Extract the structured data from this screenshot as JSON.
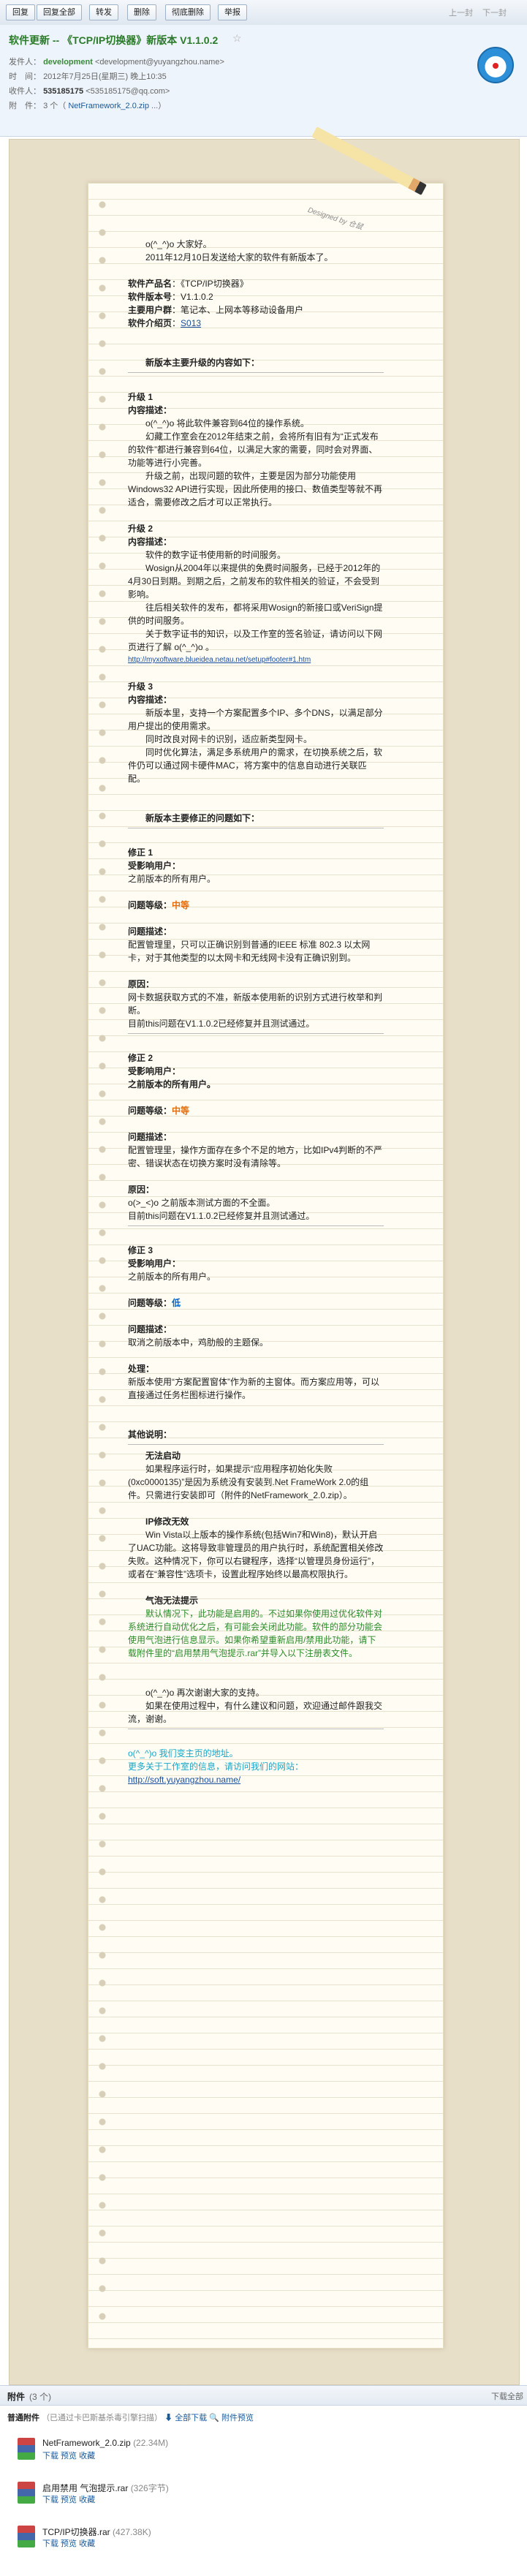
{
  "toolbar": {
    "buttons": [
      "回复",
      "回复全部",
      "转发",
      "删除",
      "彻底删除",
      "举报"
    ],
    "prev": "上一封",
    "next": "下一封"
  },
  "header": {
    "subject": "软件更新 -- 《TCP/IP切换器》新版本 V1.1.0.2",
    "star": "☆",
    "sender_label": "发件人：",
    "sender_name": "development",
    "sender_email": "<development@yuyangzhou.name>",
    "time_label": "时　间：",
    "time_value": "2012年7月25日(星期三) 晚上10:35",
    "to_label": "收件人：",
    "to_name": "535185175",
    "to_email": "<535185175@qq.com>",
    "attach_label": "附　件：",
    "attach_value": "3 个（",
    "attach_link": "NetFramework_2.0.zip",
    "attach_more": "...）"
  },
  "designed": "Designed by 仓鼠",
  "body": {
    "greet1": "o(^_^)o 大家好。",
    "greet2": "2011年12月10日发送给大家的软件有新版本了。",
    "p_name_label": "软件产品名",
    "p_name_value": "：《TCP/IP切换器》",
    "p_ver_label": "软件版本号",
    "p_ver_value": "：V1.1.0.2",
    "p_user_label": "主要用户群",
    "p_user_value": "：笔记本、上网本等移动设备用户",
    "p_intro_label": "软件介绍页",
    "p_intro_value": "S013",
    "upgrade_title": "新版本主要升级的内容如下：",
    "u1_title": "升级 1",
    "u1_desc": "内容描述：",
    "u1_p1": "o(^_^)o 将此软件兼容到64位的操作系统。",
    "u1_p2": "幻藏工作室会在2012年结束之前，会将所有旧有为“正式发布的软件”都进行兼容到64位，以满足大家的需要，同时会对界面、功能等进行小完善。",
    "u1_p3": "升级之前，出现问题的软件，主要是因为部分功能使用Windows32 API进行实现，因此所使用的接口、数值类型等就不再适合，需要修改之后才可以正常执行。",
    "u2_title": "升级 2",
    "u2_desc": "内容描述：",
    "u2_p1": "软件的数字证书使用新的时间服务。",
    "u2_p2": "Wosign从2004年以来提供的免费时间服务，已经于2012年的4月30日到期。到期之后，之前发布的软件相关的验证，不会受到影响。",
    "u2_p3": "往后相关软件的发布，都将采用Wosign的新接口或VeriSign提供的时间服务。",
    "u2_p4": "关于数字证书的知识，以及工作室的签名验证，请访问以下网页进行了解 o(^_^)o 。",
    "u2_link": "http://myxoftware.blueidea.netau.net/setup#footer#1.htm",
    "u3_title": "升级 3",
    "u3_desc": "内容描述：",
    "u3_p1": "新版本里，支持一个方案配置多个IP、多个DNS，以满足部分用户提出的使用需求。",
    "u3_p2": "同时改良对网卡的识别，适应新类型网卡。",
    "u3_p3": "同时优化算法，满足多系统用户的需求，在切换系统之后，软件仍可以通过网卡硬件MAC，将方案中的信息自动进行关联匹配。",
    "fix_title": "新版本主要修正的问题如下：",
    "f1_title": "修正 1",
    "f1_users_label": "受影响用户：",
    "f1_users": "之前版本的所有用户。",
    "f1_level_label": "问题等级：",
    "f1_level": "中等",
    "f1_desc_label": "问题描述：",
    "f1_desc": "配置管理里，只可以正确识别到普通的IEEE 标准 802.3 以太网卡，对于其他类型的以太网卡和无线网卡没有正确识别到。",
    "f1_reason_label": "原因：",
    "f1_reason1": "网卡数据获取方式的不准，新版本使用新的识别方式进行枚举和判断。",
    "f1_reason2": "目前this问题在V1.1.0.2已经修复并且测试通过。",
    "f2_title": "修正 2",
    "f2_users_label": "受影响用户：",
    "f2_users": "之前版本的所有用户。",
    "f2_level_label": "问题等级：",
    "f2_level": "中等",
    "f2_desc_label": "问题描述：",
    "f2_desc": "配置管理里，操作方面存在多个不足的地方，比如IPv4判断的不严密、错误状态在切换方案时没有清除等。",
    "f2_reason_label": "原因：",
    "f2_reason1": "o(>_<)o 之前版本测试方面的不全面。",
    "f2_reason2": "目前this问题在V1.1.0.2已经修复并且测试通过。",
    "f3_title": "修正 3",
    "f3_users_label": "受影响用户：",
    "f3_users": "之前版本的所有用户。",
    "f3_level_label": "问题等级：",
    "f3_level": "低",
    "f3_desc_label": "问题描述：",
    "f3_desc": "取消之前版本中，鸡肋般的主题保。",
    "f3_fix_label": "处理：",
    "f3_fix": "新版本使用“方案配置窗体”作为新的主窗体。而方案应用等，可以直接通过任务栏图标进行操作。",
    "other_title": "其他说明：",
    "o1_title": "无法启动",
    "o1_text": "如果程序运行时，如果提示“应用程序初始化失败(0xc0000135)”是因为系统没有安装到.Net FrameWork 2.0的组件。只需进行安装即可（附件的NetFramework_2.0.zip）。",
    "o2_title": "IP修改无效",
    "o2_text": "Win Vista以上版本的操作系统(包括Win7和Win8)，默认开启了UAC功能。这将导致非管理员的用户执行时，系统配置相关修改失败。这种情况下，你可以右键程序，选择“以管理员身份运行”，或者在“兼容性”选项卡，设置此程序始终以最高权限执行。",
    "o3_title": "气泡无法提示",
    "o3_text": "默认情况下，此功能是启用的。不过如果你使用过优化软件对系统进行自动优化之后，有可能会关闭此功能。软件的部分功能会使用气泡进行信息显示。如果你希望重新启用/禁用此功能，请下载附件里的“启用禁用气泡提示.rar”并导入以下注册表文件。",
    "end1": "o(^_^)o 再次谢谢大家的支持。",
    "end2": "如果在使用过程中，有什么建议和问题，欢迎通过邮件跟我交流，谢谢。",
    "sig1": "o(^_^)o 我们变主页的地址。",
    "sig2": "更多关于工作室的信息，请访问我们的网站：",
    "sig_link": "http://soft.yuyangzhou.name/"
  },
  "attachments": {
    "title": "附件",
    "count": "(3 个)",
    "download_all": "下载全部",
    "tip_label": "普通附件",
    "tip_text": "（已通过卡巴斯基杀毒引擎扫描）",
    "all_dl": "全部下载",
    "pack_preview": "附件预览",
    "files": [
      {
        "name": "NetFramework_2.0.zip",
        "size": "(22.34M)",
        "actions": "下载  预览  收藏"
      },
      {
        "name": "启用禁用 气泡提示.rar",
        "size": "(326字节)",
        "actions": "下载  预览  收藏"
      },
      {
        "name": "TCP/IP切换器.rar",
        "size": "(427.38K)",
        "actions": "下载  预览  收藏"
      }
    ]
  }
}
